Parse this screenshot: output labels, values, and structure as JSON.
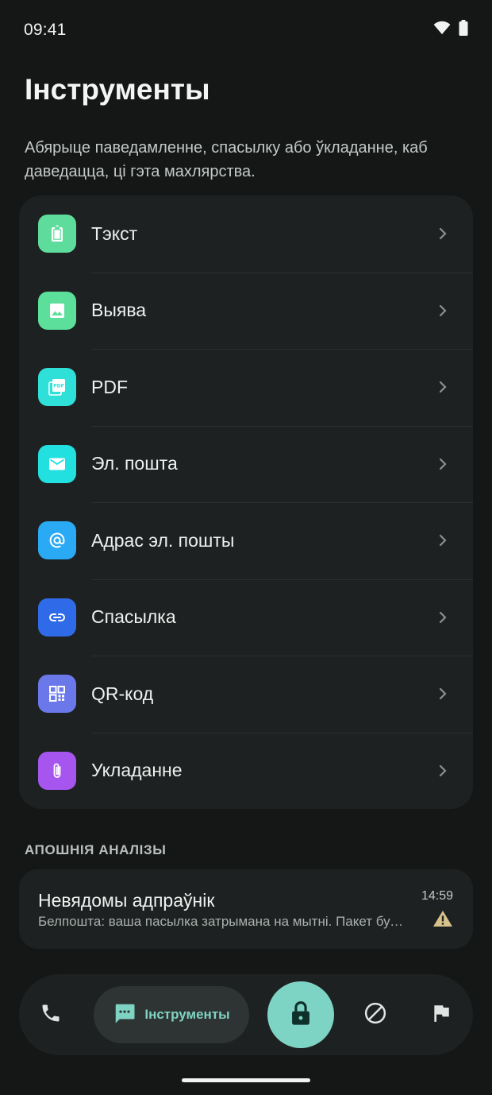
{
  "status_bar": {
    "time": "09:41"
  },
  "page": {
    "title": "Інструменты",
    "description": "Абярыце паведамленне, спасылку або ўкладанне, каб даведацца, ці гэта махлярства."
  },
  "tools": [
    {
      "label": "Тэкст",
      "icon": "clipboard-icon",
      "color": "#5ddc9c"
    },
    {
      "label": "Выява",
      "icon": "image-icon",
      "color": "#5cdf9b"
    },
    {
      "label": "PDF",
      "icon": "pdf-icon",
      "color": "#2ee0d8"
    },
    {
      "label": "Эл. пошта",
      "icon": "mail-icon",
      "color": "#22dfe0"
    },
    {
      "label": "Адрас эл. пошты",
      "icon": "at-icon",
      "color": "#2aa9f4"
    },
    {
      "label": "Спасылка",
      "icon": "link-icon",
      "color": "#2f6be8"
    },
    {
      "label": "QR-код",
      "icon": "qr-code-icon",
      "color": "#6b78ea"
    },
    {
      "label": "Укладанне",
      "icon": "paperclip-icon",
      "color": "#a656ee"
    }
  ],
  "recent": {
    "heading": "АПОШНІЯ АНАЛІЗЫ",
    "items": [
      {
        "sender": "Невядомы адпраўнік",
        "snippet": "Белпошта: ваша пасылка затрымана на мытні. Пакет будзе вернуты",
        "time": "14:59",
        "status_icon": "warning-icon",
        "status_color": "#d8c28a"
      }
    ]
  },
  "bottom_nav": {
    "items": [
      {
        "name": "calls",
        "icon": "phone-icon"
      },
      {
        "name": "tools",
        "icon": "chat-dots-icon",
        "label": "Інструменты",
        "active": true
      },
      {
        "name": "protection",
        "icon": "lock-icon"
      },
      {
        "name": "blocked",
        "icon": "block-icon"
      },
      {
        "name": "reports",
        "icon": "flag-icon"
      }
    ],
    "accent_color": "#7dd3c4"
  }
}
